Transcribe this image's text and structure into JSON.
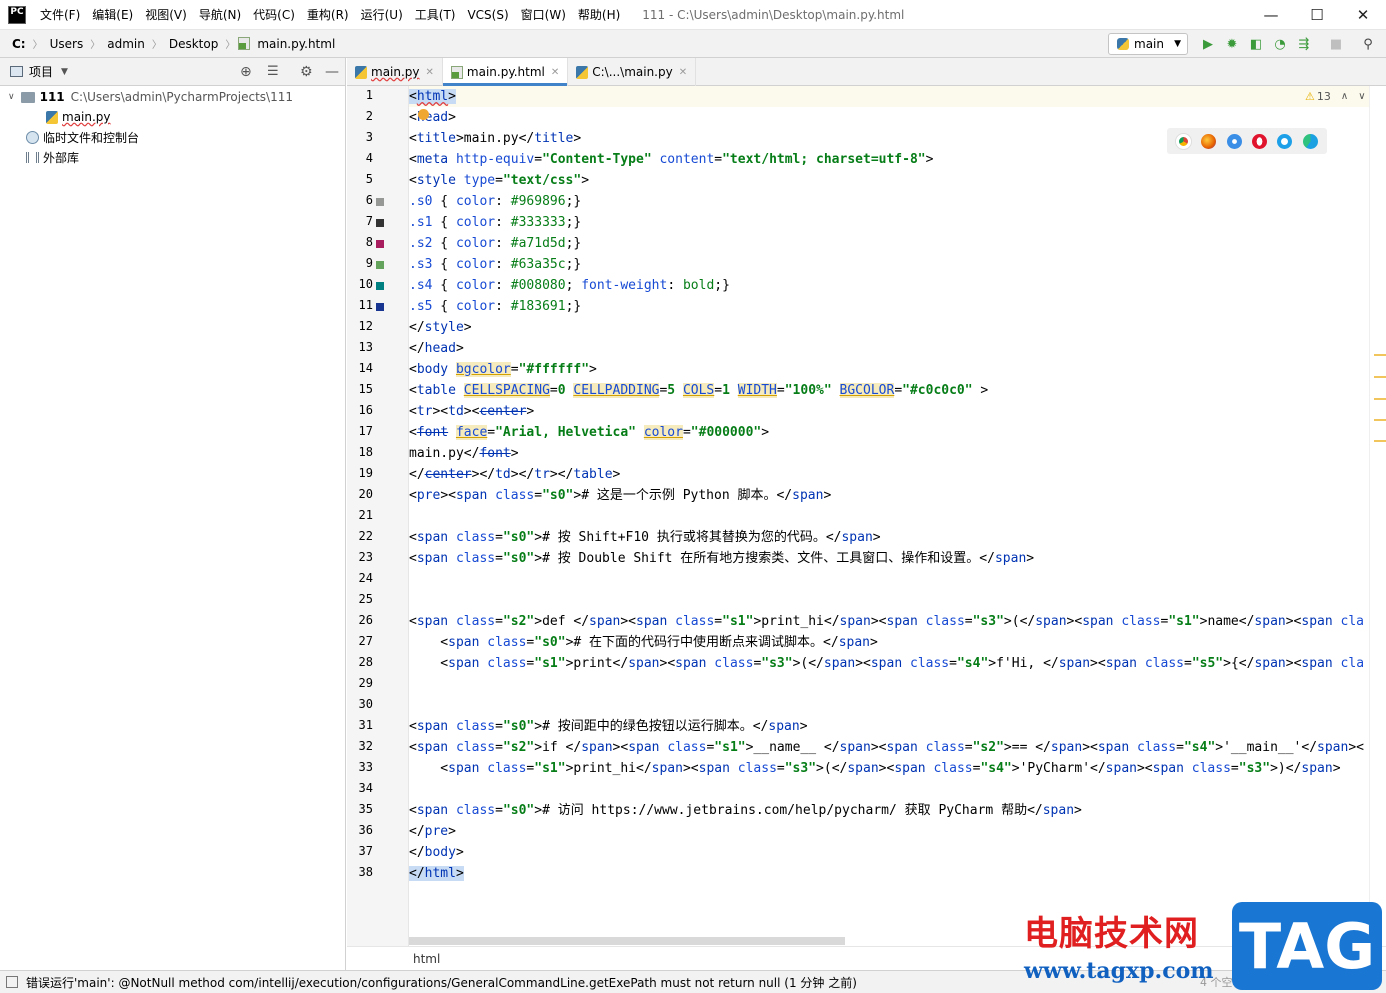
{
  "titlebar": {
    "logo": "PC",
    "menus": [
      "文件(F)",
      "编辑(E)",
      "视图(V)",
      "导航(N)",
      "代码(C)",
      "重构(R)",
      "运行(U)",
      "工具(T)",
      "VCS(S)",
      "窗口(W)",
      "帮助(H)"
    ],
    "title": "111 - C:\\Users\\admin\\Desktop\\main.py.html",
    "minimize": "—",
    "maximize": "☐",
    "close": "✕"
  },
  "navbar": {
    "crumbs": [
      "C:",
      "Users",
      "admin",
      "Desktop",
      "main.py.html"
    ],
    "run_config": "main"
  },
  "project": {
    "header": "项目",
    "tree": [
      {
        "label": "111",
        "path": "C:\\Users\\admin\\PycharmProjects\\111"
      },
      {
        "label": "main.py"
      },
      {
        "label": "临时文件和控制台"
      },
      {
        "label": "外部库"
      }
    ]
  },
  "tabs": [
    {
      "label": "main.py",
      "active": false
    },
    {
      "label": "main.py.html",
      "active": true
    },
    {
      "label": "C:\\...\\main.py",
      "active": false
    }
  ],
  "editor": {
    "line_numbers": [
      "1",
      "2",
      "3",
      "4",
      "5",
      "6",
      "7",
      "8",
      "9",
      "10",
      "11",
      "12",
      "13",
      "14",
      "15",
      "16",
      "17",
      "18",
      "19",
      "20",
      "21",
      "22",
      "23",
      "24",
      "25",
      "26",
      "27",
      "28",
      "29",
      "30",
      "31",
      "32",
      "33",
      "34",
      "35",
      "36",
      "37",
      "38"
    ],
    "warnings_count": "13",
    "swatches": [
      "#969896",
      "#333333",
      "#a71d5d",
      "#63a35c",
      "#008080",
      "#183691"
    ],
    "browser_icons": [
      "chrome-icon",
      "firefox-icon",
      "safari-icon",
      "opera-icon",
      "ie-icon",
      "edge-icon"
    ]
  },
  "bottom_breadcrumb": "html",
  "statusbar": {
    "message": "错误运行'main': @NotNull method com/intellij/execution/configurations/GeneralCommandLine.getExePath must not return null (1 分钟 之前)",
    "right": "4 个空格"
  },
  "watermark": {
    "title": "电脑技术网",
    "url": "www.tagxp.com",
    "tag": "TAG"
  }
}
